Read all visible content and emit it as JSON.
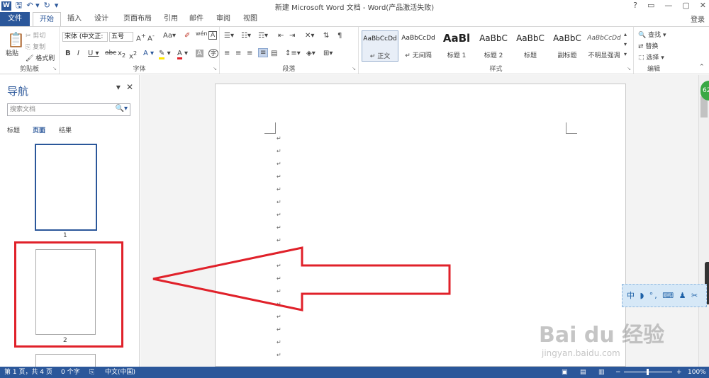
{
  "window": {
    "title": "新建 Microsoft Word 文档 - Word(产品激活失败)",
    "controls": [
      "?",
      "▭",
      "—",
      "▢",
      "✕"
    ]
  },
  "ribbon_tabs": [
    {
      "label": "文件"
    },
    {
      "label": "开始"
    },
    {
      "label": "插入"
    },
    {
      "label": "设计"
    },
    {
      "label": "页面布局"
    },
    {
      "label": "引用"
    },
    {
      "label": "邮件"
    },
    {
      "label": "审阅"
    },
    {
      "label": "视图"
    }
  ],
  "login_label": "登录",
  "clipboard": {
    "paste": "粘贴",
    "cut": "剪切",
    "copy": "复制",
    "format_painter": "格式刷",
    "group": "剪贴板"
  },
  "font": {
    "name": "宋体 (中文正:",
    "size": "五号",
    "group": "字体"
  },
  "paragraph": {
    "group": "段落"
  },
  "styles": {
    "group": "样式",
    "items": [
      {
        "sample": "AaBbCcDd",
        "name": "↵ 正文"
      },
      {
        "sample": "AaBbCcDd",
        "name": "↵ 无间隔"
      },
      {
        "sample": "AaBl",
        "name": "标题 1"
      },
      {
        "sample": "AaBbC",
        "name": "标题 2"
      },
      {
        "sample": "AaBbC",
        "name": "标题"
      },
      {
        "sample": "AaBbC",
        "name": "副标题"
      },
      {
        "sample": "AaBbCcDd",
        "name": "不明显强调"
      }
    ]
  },
  "editing": {
    "find": "查找",
    "replace": "替换",
    "select": "选择",
    "group": "编辑"
  },
  "navigation": {
    "title": "导航",
    "search_placeholder": "搜索文档",
    "tabs": [
      "标题",
      "页面",
      "结果"
    ],
    "pages": [
      "1",
      "2"
    ]
  },
  "green_badge": "62",
  "float_toolbar": "中 ◗ °, ⌨ ♟ ✂",
  "watermark": {
    "main": "Bai du 经验",
    "sub": "jingyan.baidu.com"
  },
  "status": {
    "page": "第 1 页，共 4 页",
    "words": "0 个字",
    "language": "中文(中国)",
    "zoom": "100%"
  },
  "colors": {
    "accent": "#2b579a",
    "highlight_box": "#e0212a",
    "arrow": "#e0212a"
  }
}
